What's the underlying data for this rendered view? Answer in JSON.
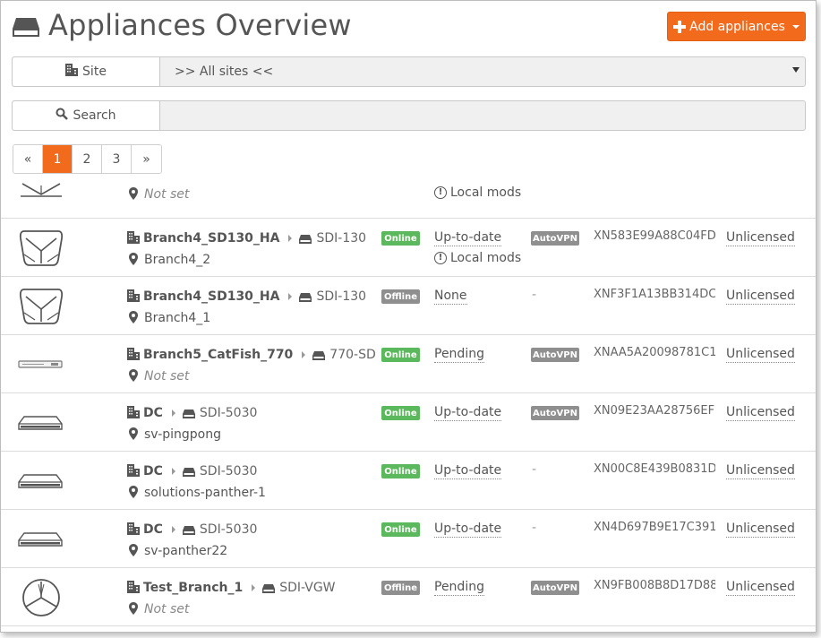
{
  "page": {
    "title": "Appliances Overview",
    "add_button": "Add appliances"
  },
  "filters": {
    "site_label": "Site",
    "site_value": ">> All sites <<",
    "search_label": "Search",
    "search_value": ""
  },
  "pagination": {
    "prev": "«",
    "pages": [
      "1",
      "2",
      "3"
    ],
    "active": "1",
    "next": "»"
  },
  "partial_row": {
    "location": "Not set",
    "firmware_note": "Local mods"
  },
  "rows": [
    {
      "site": "Branch4_SD130_HA",
      "model": "SDI-130",
      "location": "Branch4_2",
      "location_empty": false,
      "status": "Online",
      "firmware": "Up-to-date",
      "firmware_note": "Local mods",
      "vpn": "AutoVPN",
      "serial": "XN583E99A88C04FD",
      "license": "Unlicensed",
      "device": "sdi-130"
    },
    {
      "site": "Branch4_SD130_HA",
      "model": "SDI-130",
      "location": "Branch4_1",
      "location_empty": false,
      "status": "Offline",
      "firmware": "None",
      "firmware_note": "",
      "vpn": "-",
      "serial": "XNF3F1A13BB314DC",
      "license": "Unlicensed",
      "device": "sdi-130"
    },
    {
      "site": "Branch5_CatFish_770",
      "model": "770-SD",
      "location": "Not set",
      "location_empty": true,
      "status": "Online",
      "firmware": "Pending",
      "firmware_note": "",
      "vpn": "AutoVPN",
      "serial": "XNAA5A20098781C1",
      "license": "Unlicensed",
      "device": "770"
    },
    {
      "site": "DC",
      "model": "SDI-5030",
      "location": "sv-pingpong",
      "location_empty": false,
      "status": "Online",
      "firmware": "Up-to-date",
      "firmware_note": "",
      "vpn": "AutoVPN",
      "serial": "XN09E23AA28756EF",
      "license": "Unlicensed",
      "device": "rack"
    },
    {
      "site": "DC",
      "model": "SDI-5030",
      "location": "solutions-panther-1",
      "location_empty": false,
      "status": "Online",
      "firmware": "Up-to-date",
      "firmware_note": "",
      "vpn": "-",
      "serial": "XN00C8E439B0831D",
      "license": "Unlicensed",
      "device": "rack"
    },
    {
      "site": "DC",
      "model": "SDI-5030",
      "location": "sv-panther22",
      "location_empty": false,
      "status": "Online",
      "firmware": "Up-to-date",
      "firmware_note": "",
      "vpn": "-",
      "serial": "XN4D697B9E17C391",
      "license": "Unlicensed",
      "device": "rack"
    },
    {
      "site": "Test_Branch_1",
      "model": "SDI-VGW",
      "location": "Not set",
      "location_empty": true,
      "status": "Offline",
      "firmware": "Pending",
      "firmware_note": "",
      "vpn": "AutoVPN",
      "serial": "XN9FB008B8D17D88",
      "license": "Unlicensed",
      "device": "vgw"
    }
  ],
  "colors": {
    "accent": "#f26b1d",
    "online": "#5cb85c",
    "offline": "#8f8f8f"
  }
}
